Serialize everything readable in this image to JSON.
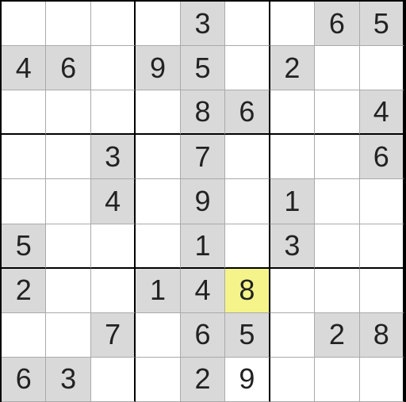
{
  "sudoku": {
    "rows": [
      [
        {
          "v": "",
          "given": false
        },
        {
          "v": "",
          "given": false
        },
        {
          "v": "",
          "given": false
        },
        {
          "v": "",
          "given": false
        },
        {
          "v": "3",
          "given": true
        },
        {
          "v": "",
          "given": false
        },
        {
          "v": "",
          "given": false
        },
        {
          "v": "6",
          "given": true
        },
        {
          "v": "5",
          "given": true
        }
      ],
      [
        {
          "v": "4",
          "given": true
        },
        {
          "v": "6",
          "given": true
        },
        {
          "v": "",
          "given": false
        },
        {
          "v": "9",
          "given": true
        },
        {
          "v": "5",
          "given": true
        },
        {
          "v": "",
          "given": false
        },
        {
          "v": "2",
          "given": true
        },
        {
          "v": "",
          "given": false
        },
        {
          "v": "",
          "given": false
        }
      ],
      [
        {
          "v": "",
          "given": false
        },
        {
          "v": "",
          "given": false
        },
        {
          "v": "",
          "given": false
        },
        {
          "v": "",
          "given": false
        },
        {
          "v": "8",
          "given": true
        },
        {
          "v": "6",
          "given": true
        },
        {
          "v": "",
          "given": false
        },
        {
          "v": "",
          "given": false
        },
        {
          "v": "4",
          "given": true
        }
      ],
      [
        {
          "v": "",
          "given": false
        },
        {
          "v": "",
          "given": false
        },
        {
          "v": "3",
          "given": true
        },
        {
          "v": "",
          "given": false
        },
        {
          "v": "7",
          "given": true
        },
        {
          "v": "",
          "given": false
        },
        {
          "v": "",
          "given": false
        },
        {
          "v": "",
          "given": false
        },
        {
          "v": "6",
          "given": true
        }
      ],
      [
        {
          "v": "",
          "given": false
        },
        {
          "v": "",
          "given": false
        },
        {
          "v": "4",
          "given": true
        },
        {
          "v": "",
          "given": false
        },
        {
          "v": "9",
          "given": true
        },
        {
          "v": "",
          "given": false
        },
        {
          "v": "1",
          "given": true
        },
        {
          "v": "",
          "given": false
        },
        {
          "v": "",
          "given": false
        }
      ],
      [
        {
          "v": "5",
          "given": true
        },
        {
          "v": "",
          "given": false
        },
        {
          "v": "",
          "given": false
        },
        {
          "v": "",
          "given": false
        },
        {
          "v": "1",
          "given": true
        },
        {
          "v": "",
          "given": false
        },
        {
          "v": "3",
          "given": true
        },
        {
          "v": "",
          "given": false
        },
        {
          "v": "",
          "given": false
        }
      ],
      [
        {
          "v": "2",
          "given": true
        },
        {
          "v": "",
          "given": false
        },
        {
          "v": "",
          "given": false
        },
        {
          "v": "1",
          "given": true
        },
        {
          "v": "4",
          "given": true
        },
        {
          "v": "8",
          "given": false,
          "selected": true
        },
        {
          "v": "",
          "given": false
        },
        {
          "v": "",
          "given": false
        },
        {
          "v": "",
          "given": false
        }
      ],
      [
        {
          "v": "",
          "given": false
        },
        {
          "v": "",
          "given": false
        },
        {
          "v": "7",
          "given": true
        },
        {
          "v": "",
          "given": false
        },
        {
          "v": "6",
          "given": true
        },
        {
          "v": "5",
          "given": true
        },
        {
          "v": "",
          "given": false
        },
        {
          "v": "2",
          "given": true
        },
        {
          "v": "8",
          "given": true
        }
      ],
      [
        {
          "v": "6",
          "given": true
        },
        {
          "v": "3",
          "given": true
        },
        {
          "v": "",
          "given": false
        },
        {
          "v": "",
          "given": false
        },
        {
          "v": "2",
          "given": true
        },
        {
          "v": "9",
          "given": false
        },
        {
          "v": "",
          "given": false
        },
        {
          "v": "",
          "given": false
        },
        {
          "v": "",
          "given": false
        }
      ]
    ]
  }
}
